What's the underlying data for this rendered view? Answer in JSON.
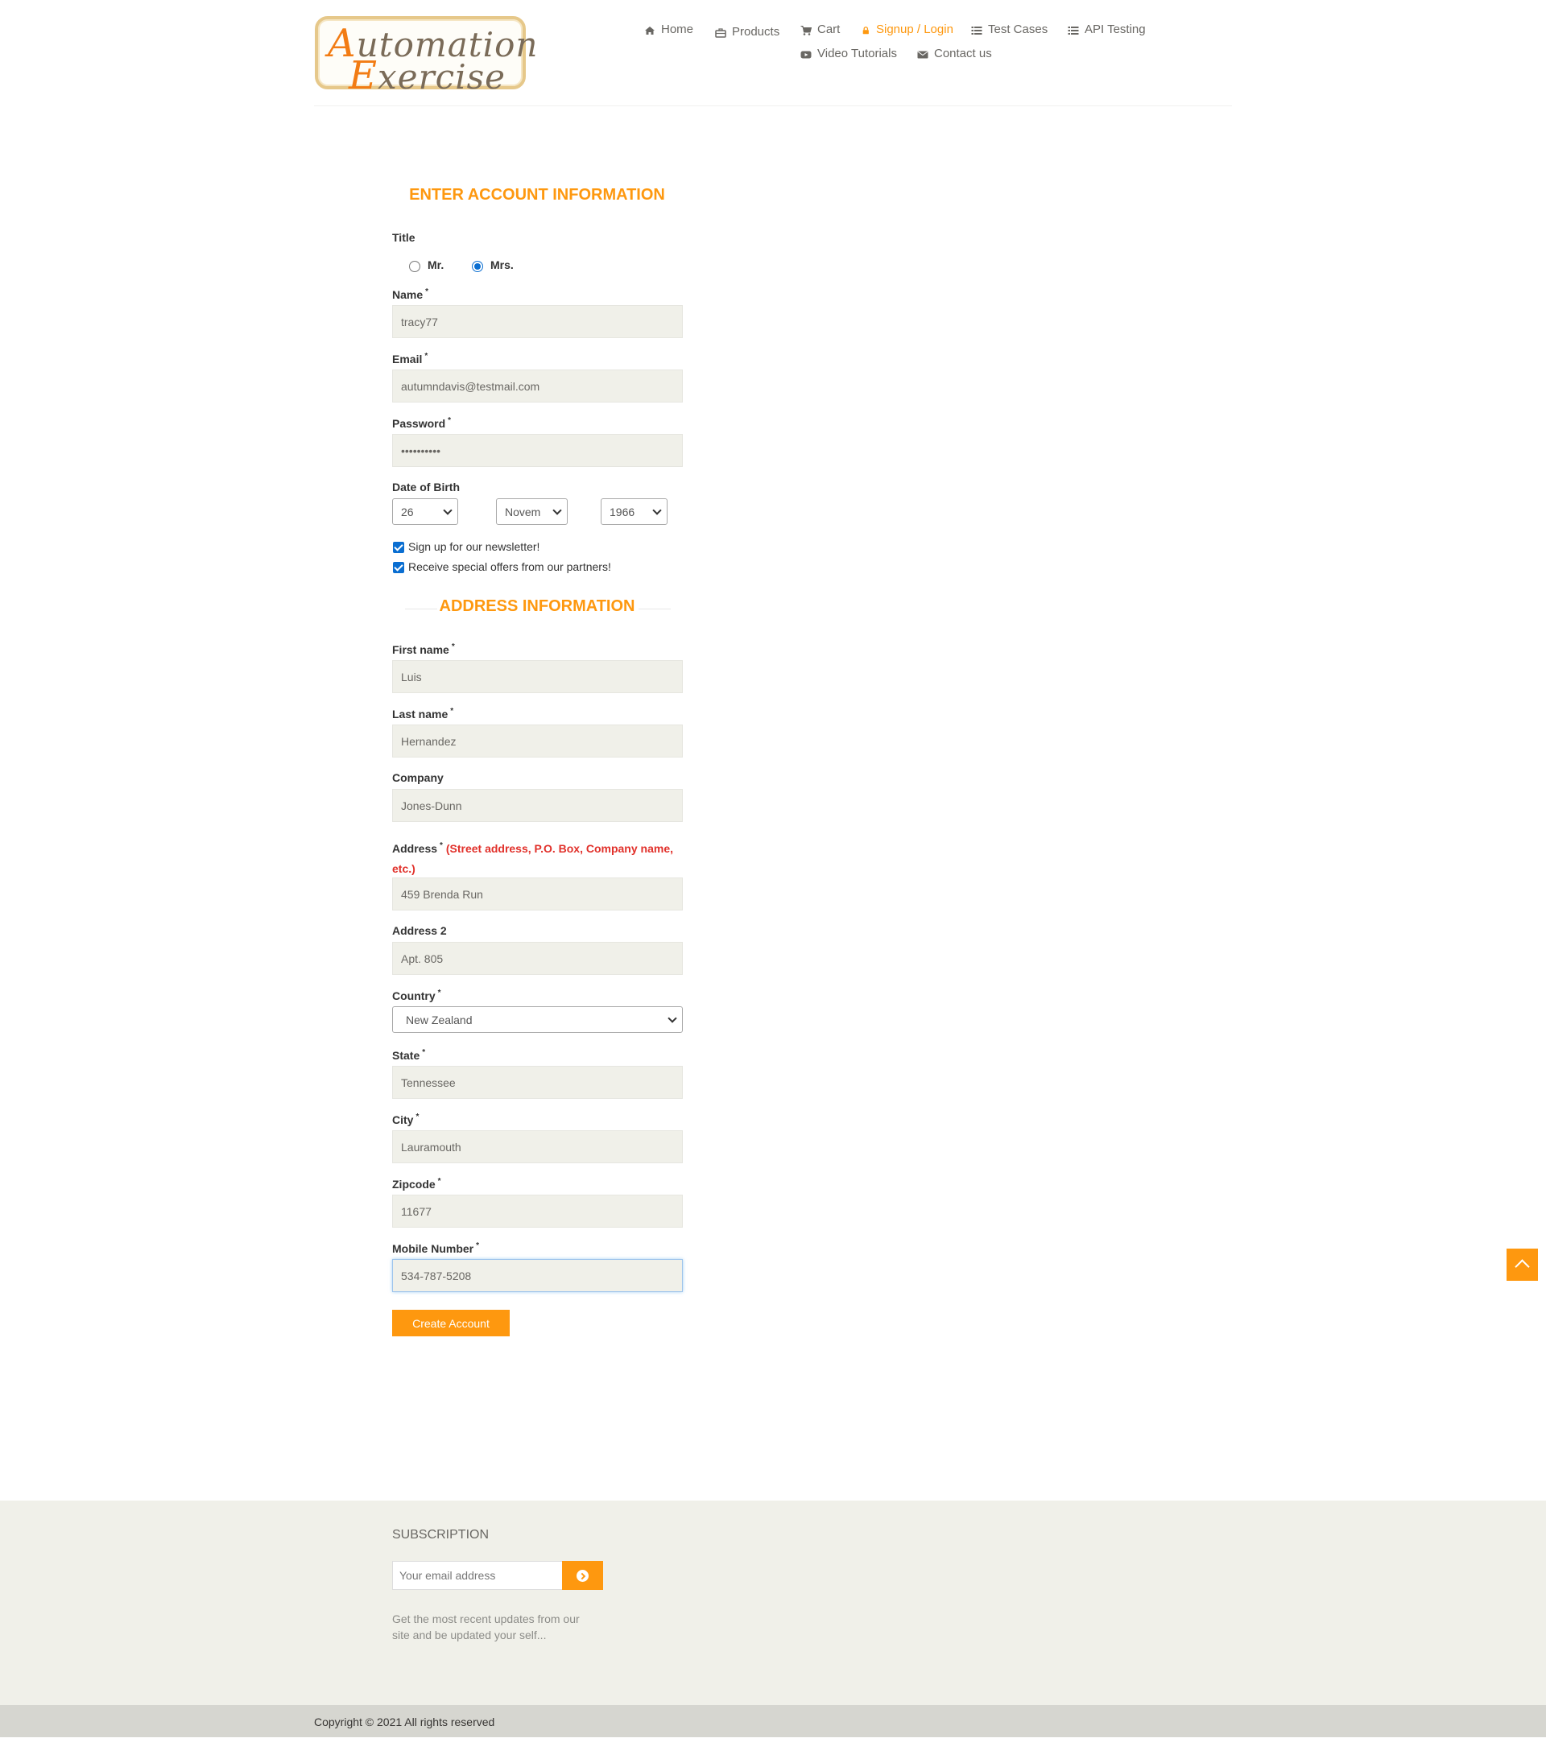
{
  "header": {
    "logo_line1": "Automation",
    "logo_line2": "Exercise",
    "nav": {
      "home": "Home",
      "products": "Products",
      "cart": "Cart",
      "signup_login": "Signup / Login",
      "test_cases": "Test Cases",
      "api_testing": "API Testing",
      "video_tutorials": "Video Tutorials",
      "contact_us": "Contact us"
    },
    "active_color": "#fe980f"
  },
  "account": {
    "heading": "ENTER ACCOUNT INFORMATION",
    "title_label": "Title",
    "title_options": {
      "mr": "Mr.",
      "mrs": "Mrs."
    },
    "title_selected": "Mrs.",
    "name_label": "Name",
    "name_value": "tracy77",
    "email_label": "Email",
    "email_value": "autumndavis@testmail.com",
    "password_label": "Password",
    "password_value": "••••••••••",
    "dob_label": "Date of Birth",
    "dob_day": "26",
    "dob_month": "Novem",
    "dob_year": "1966",
    "newsletter_label": "Sign up for our newsletter!",
    "offers_label": "Receive special offers from our partners!",
    "required_mark": "*"
  },
  "address": {
    "heading": "ADDRESS INFORMATION",
    "first_name_label": "First name",
    "first_name_value": "Luis",
    "last_name_label": "Last name",
    "last_name_value": "Hernandez",
    "company_label": "Company",
    "company_value": "Jones-Dunn",
    "address_label": "Address",
    "address_hint": "(Street address, P.O. Box, Company name, etc.)",
    "address_value": "459 Brenda Run",
    "address2_label": "Address 2",
    "address2_value": "Apt. 805",
    "country_label": "Country",
    "country_value": "New Zealand",
    "state_label": "State",
    "state_value": "Tennessee",
    "city_label": "City",
    "city_value": "Lauramouth",
    "zipcode_label": "Zipcode",
    "zipcode_value": "11677",
    "mobile_label": "Mobile Number",
    "mobile_value": "534-787-5208",
    "create_button": "Create Account"
  },
  "footer": {
    "subscription_title": "SUBSCRIPTION",
    "email_placeholder": "Your email address",
    "note": "Get the most recent updates from our site and be updated your self...",
    "copyright": "Copyright © 2021 All rights reserved"
  },
  "icons": {
    "home": "home-icon",
    "products": "briefcase-icon",
    "cart": "cart-icon",
    "login": "lock-icon",
    "test_cases": "list-icon",
    "api": "list-icon",
    "video": "youtube-play-icon",
    "contact": "envelope-icon",
    "scroll_up": "chevron-up-icon",
    "subscribe": "arrow-circle-right-icon"
  },
  "colors": {
    "accent": "#fe980f",
    "input_bg": "#f0f0e9",
    "footer_bg": "#f0f0e9",
    "footer_bottom_bg": "#d6d6d0",
    "hint_red": "#e1302a"
  }
}
